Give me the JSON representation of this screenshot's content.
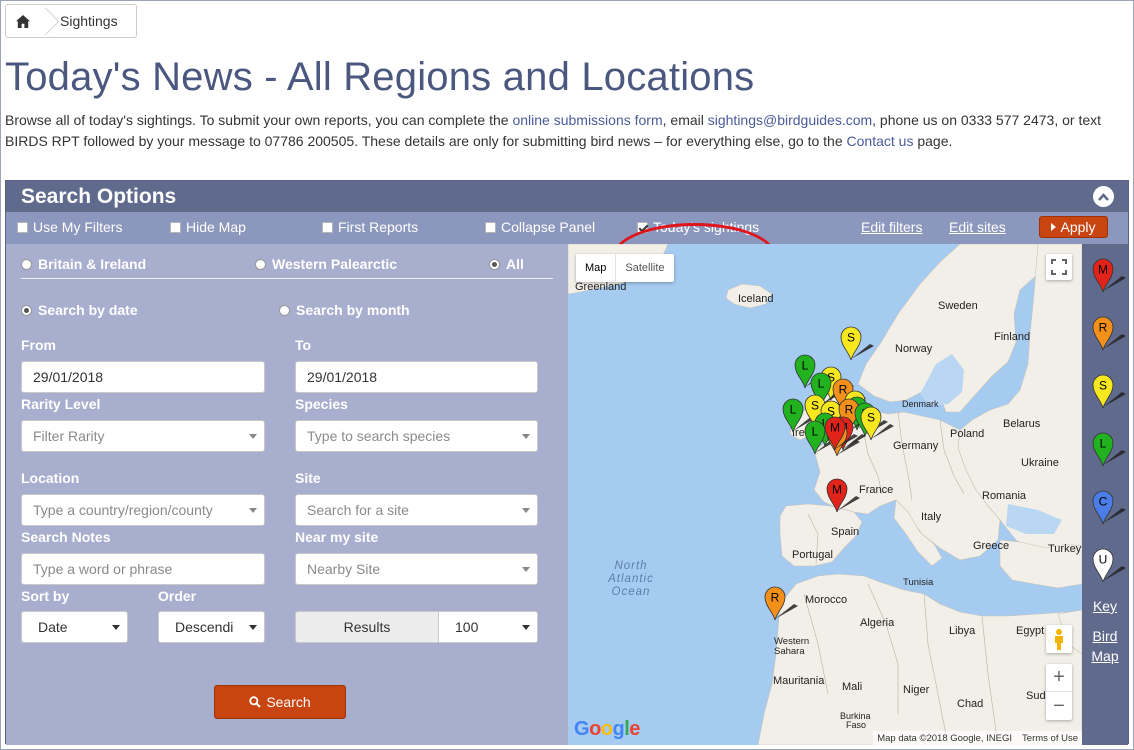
{
  "breadcrumb": {
    "home_icon": "home-icon",
    "items": [
      "Sightings"
    ]
  },
  "page": {
    "title": "Today's News - All Regions and Locations",
    "intro": {
      "part1": "Browse all of today's sightings. To submit your own reports, you can complete the ",
      "link1": "online submissions form",
      "part2": ", email ",
      "link2": "sightings@birdguides.com",
      "part3": ", phone us on 0333 577 2473, or text BIRDS RPT followed by your message to 07786 200505. These details are only for submitting bird news – for everything else, go to the ",
      "link3": "Contact us",
      "part4": " page."
    }
  },
  "search_panel": {
    "title": "Search Options",
    "toolbar": {
      "checkboxes": [
        {
          "label": "Use My Filters",
          "checked": false
        },
        {
          "label": "Hide Map",
          "checked": false
        },
        {
          "label": "First Reports",
          "checked": false
        },
        {
          "label": "Collapse Panel",
          "checked": false
        },
        {
          "label": "Today's sightings",
          "checked": true
        }
      ],
      "links": [
        "Edit filters",
        "Edit sites"
      ],
      "apply_label": "Apply"
    },
    "regions": [
      {
        "label": "Britain & Ireland",
        "selected": false
      },
      {
        "label": "Western Palearctic",
        "selected": false
      },
      {
        "label": "All",
        "selected": true
      }
    ],
    "search_modes": [
      {
        "label": "Search by date",
        "selected": true
      },
      {
        "label": "Search by month",
        "selected": false
      }
    ],
    "labels": {
      "from": "From",
      "to": "To",
      "rarity": "Rarity Level",
      "species": "Species",
      "location": "Location",
      "site": "Site",
      "notes": "Search Notes",
      "near_site": "Near my site",
      "sort_by": "Sort by",
      "order": "Order"
    },
    "fields": {
      "from_value": "29/01/2018",
      "to_value": "29/01/2018",
      "rarity_placeholder": "Filter Rarity",
      "species_placeholder": "Type to search species",
      "location_placeholder": "Type a country/region/county",
      "site_placeholder": "Search for a site",
      "notes_placeholder": "Type a word or phrase",
      "near_site_value": "Nearby Site",
      "sort_value": "Date",
      "order_value": "Descendi",
      "results_label": "Results",
      "results_value": "100"
    },
    "search_label": "Search"
  },
  "map": {
    "type_buttons": [
      "Map",
      "Satellite"
    ],
    "labels": {
      "greenland": "Greenland",
      "iceland": "Iceland",
      "sweden": "Sweden",
      "norway": "Norway",
      "finland": "Finland",
      "denmark": "Denmark",
      "ireland": "Irel",
      "poland": "Poland",
      "belarus": "Belarus",
      "germany": "Germany",
      "ukraine": "Ukraine",
      "france": "France",
      "romania": "Romania",
      "italy": "Italy",
      "spain": "Spain",
      "portugal": "Portugal",
      "greece": "Greece",
      "turkey": "Turkey",
      "tunisia": "Tunisia",
      "morocco": "Morocco",
      "algeria": "Algeria",
      "libya": "Libya",
      "egypt": "Egypt",
      "western_sahara_1": "Western",
      "western_sahara_2": "Sahara",
      "mauritania": "Mauritania",
      "mali": "Mali",
      "niger": "Niger",
      "chad": "Chad",
      "sudan": "Suda",
      "burkina_1": "Burkina",
      "burkina_2": "Faso",
      "ocean_1": "North",
      "ocean_2": "Atlantic",
      "ocean_3": "Ocean"
    },
    "google": "Google",
    "footer_data": "Map data ©2018 Google, INEGI",
    "footer_terms": "Terms of Use",
    "zoom_in": "+",
    "zoom_out": "−"
  },
  "key": {
    "pins": [
      {
        "letter": "M",
        "color": "#e2231a"
      },
      {
        "letter": "R",
        "color": "#f39019"
      },
      {
        "letter": "S",
        "color": "#f6e71f"
      },
      {
        "letter": "L",
        "color": "#22b11f"
      },
      {
        "letter": "C",
        "color": "#4a7ee6"
      },
      {
        "letter": "U",
        "color": "#ffffff"
      }
    ],
    "key_link": "Key",
    "bird_map_1": "Bird",
    "bird_map_2": "Map"
  },
  "colors": {
    "title": "#4a5880",
    "panel_header": "#5f6a8c",
    "toolbar": "#8c97bd",
    "form_bg": "#a7aece",
    "button": "#c84410",
    "highlight": "#e0141b"
  }
}
